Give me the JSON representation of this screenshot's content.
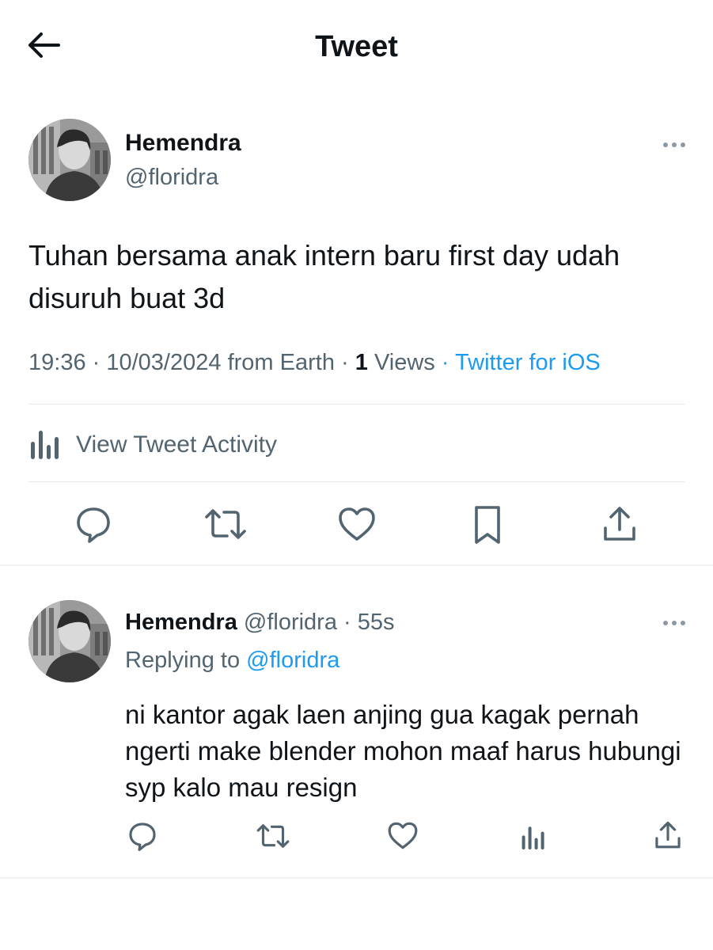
{
  "header": {
    "title": "Tweet"
  },
  "main_tweet": {
    "author_name": "Hemendra",
    "author_handle": "@floridra",
    "text": "Tuhan bersama anak intern baru first day udah disuruh buat 3d",
    "time": "19:36",
    "date": "10/03/2024",
    "location_text": "from Earth",
    "views_count": "1",
    "views_label": "Views",
    "source": "Twitter for iOS",
    "activity_label": "View Tweet Activity"
  },
  "reply": {
    "author_name": "Hemendra",
    "author_handle": "@floridra",
    "time": "55s",
    "replying_prefix": "Replying to",
    "replying_to": "@floridra",
    "text": "ni kantor agak laen anjing gua kagak pernah ngerti make blender mohon maaf harus hubungi syp kalo mau resign"
  },
  "icons": {
    "back": "arrow-left-icon",
    "more": "more-horizontal-icon",
    "activity": "bar-chart-icon",
    "reply": "comment-icon",
    "retweet": "retweet-icon",
    "like": "heart-icon",
    "bookmark": "bookmark-icon",
    "share": "share-icon",
    "views": "views-icon"
  },
  "colors": {
    "text_primary": "#0f1419",
    "text_secondary": "#536471",
    "link": "#1d9bf0",
    "divider": "#eff3f4"
  }
}
